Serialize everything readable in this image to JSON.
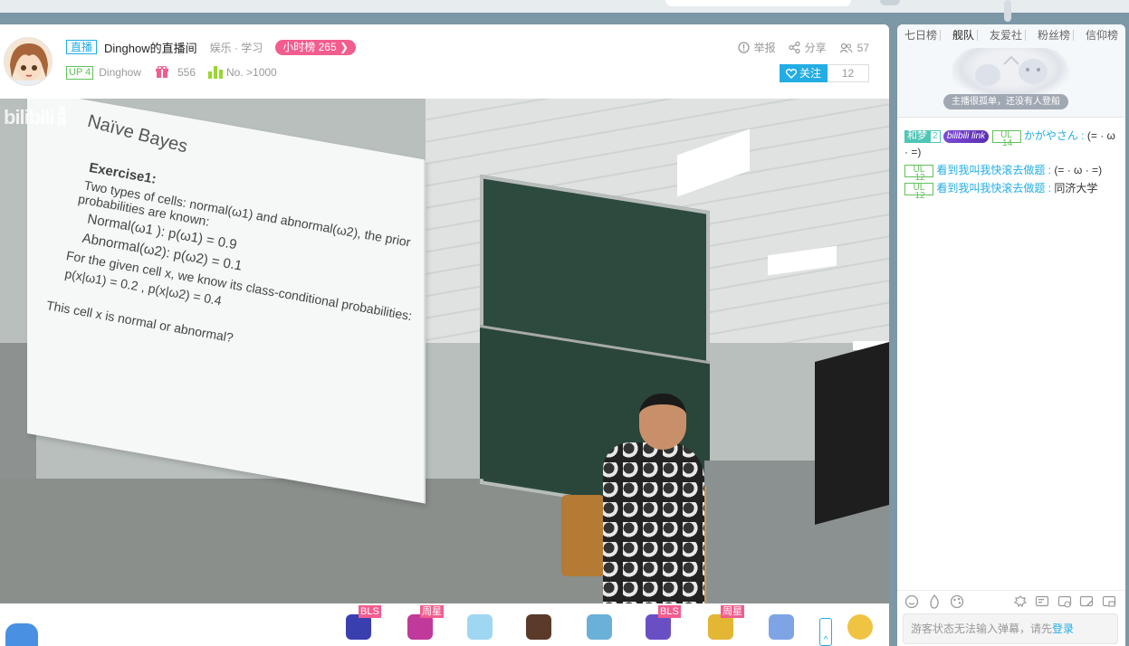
{
  "header": {
    "live_tag": "直播",
    "room_title": "Dinghow的直播间",
    "category": "娱乐 · 学习",
    "hour_rank": "小时榜 265 ❯",
    "up_level": "UP 4",
    "up_name": "Dinghow",
    "gift_count": "556",
    "rank_text": "No. >1000",
    "report": "举报",
    "share": "分享",
    "viewers": "57",
    "follow_label": "关注",
    "follow_count": "12"
  },
  "video": {
    "watermark": "bilibili",
    "watermark_sub": "直播",
    "slide": {
      "title": "Naïve Bayes",
      "exercise": "Exercise1:",
      "lines": [
        "Two types of cells:  normal(ω1) and abnormal(ω2), the prior",
        "probabilities are known:",
        "Normal(ω1 ):   p(ω1) = 0.9",
        "Abnormal(ω2):     p(ω2) = 0.1",
        "For the given cell x,  we know its class-conditional probabilities:",
        "p(x|ω1) = 0.2 , p(x|ω2) = 0.4",
        "This cell x is normal or abnormal?"
      ]
    }
  },
  "giftbar": {
    "items": [
      {
        "name": "gift-1",
        "flag": "BLS",
        "color": "#3a3fb0"
      },
      {
        "name": "gift-2",
        "flag": "周星",
        "color": "#c1399b"
      },
      {
        "name": "gift-3",
        "flag": "",
        "color": "#9fd6f2"
      },
      {
        "name": "gift-4",
        "flag": "",
        "color": "#5b3a2a"
      },
      {
        "name": "gift-5",
        "flag": "",
        "color": "#6ab0d8"
      },
      {
        "name": "gift-6",
        "flag": "BLS",
        "color": "#6a4fc4"
      },
      {
        "name": "gift-7",
        "flag": "周星",
        "color": "#e3b634"
      },
      {
        "name": "gift-8",
        "flag": "",
        "color": "#7fa4e6"
      }
    ],
    "expand": "^"
  },
  "sidebar": {
    "tabs": [
      {
        "label": "七日榜",
        "active": false
      },
      {
        "label": "舰队",
        "active": true
      },
      {
        "label": "友爱社",
        "active": false
      },
      {
        "label": "粉丝榜",
        "active": false
      },
      {
        "label": "信仰榜",
        "active": false
      }
    ],
    "empty_tip": "主播很孤单，还没有人登船",
    "messages": [
      {
        "medal": "和梦",
        "medal_lv": "2",
        "link": "bilibili link",
        "ul": "UL",
        "ul_lv": "14",
        "user": "かがやさん :",
        "text": "(= · ω · =)"
      },
      {
        "ul": "UL",
        "ul_lv": "12",
        "user": "看到我叫我快滚去做题 :",
        "text": "(= · ω · =)"
      },
      {
        "ul": "UL",
        "ul_lv": "12",
        "user": "看到我叫我快滚去做题 :",
        "text": "同济大学"
      }
    ],
    "input_placeholder": "游客状态无法输入弹幕，请先",
    "login": "登录"
  },
  "colors": {
    "accent": "#23ade5",
    "pink": "#f25d8e",
    "green": "#61c05a"
  }
}
